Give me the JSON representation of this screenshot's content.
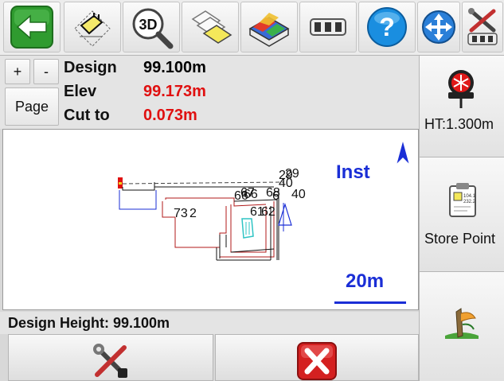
{
  "toolbar": {
    "buttons": [
      {
        "icon": "back-arrow-icon"
      },
      {
        "icon": "plan-view-icon"
      },
      {
        "icon": "3d-zoom-icon",
        "label": "3D"
      },
      {
        "icon": "layers-icon"
      },
      {
        "icon": "surface-map-icon"
      },
      {
        "icon": "keypad-icon"
      },
      {
        "icon": "help-icon",
        "label": "?"
      },
      {
        "icon": "pan-arrows-icon"
      },
      {
        "icon": "tools-settings-icon"
      }
    ]
  },
  "nav": {
    "plus": "+",
    "minus": "-",
    "page": "Page"
  },
  "info": {
    "design_label": "Design",
    "design_value": "99.100m",
    "elev_label": "Elev",
    "elev_value": "99.173m",
    "cut_label": "Cut to",
    "cut_value": "0.073m",
    "value_color_normal": "#000000",
    "value_color_alert": "#e01010"
  },
  "map": {
    "instrument_label": "Inst",
    "scale_label": "20m",
    "point_labels": [
      "73",
      "2",
      "61",
      "62",
      "66",
      "67",
      "68",
      "6",
      "40",
      "29"
    ]
  },
  "right_panel": {
    "height_label": "HT:1.300m",
    "store_label": "Store Point",
    "note_text_1": "104.1",
    "note_text_2": "232.2"
  },
  "status": {
    "text": "Design Height: 99.100m"
  },
  "colors": {
    "accent_blue": "#1a2ed6",
    "red": "#e01010",
    "green": "#2e9a2e"
  }
}
